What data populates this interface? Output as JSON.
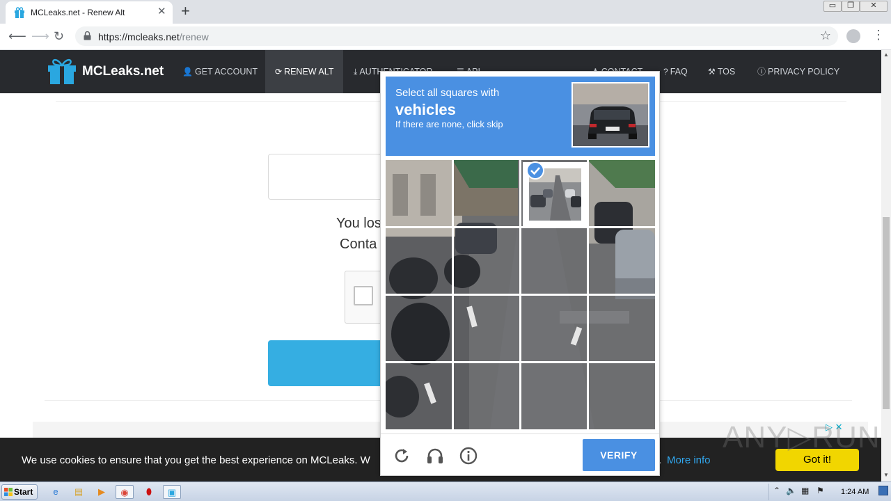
{
  "browser": {
    "tab_title": "MCLeaks.net - Renew Alt",
    "tab_close": "✕",
    "new_tab": "+",
    "url_host": "https://mcleaks.net",
    "url_path": "/renew",
    "window_buttons": [
      "▭",
      "❐",
      "✕"
    ]
  },
  "site": {
    "logo_text": "MCLeaks.net",
    "nav": [
      {
        "icon": "user-plus-icon",
        "label": "GET ACCOUNT"
      },
      {
        "icon": "refresh-icon",
        "label": "RENEW ALT"
      },
      {
        "icon": "download-icon",
        "label": "AUTHENTICATOR"
      },
      {
        "icon": "list-icon",
        "label": "API"
      },
      {
        "icon": "person-icon",
        "label": "CONTACT"
      },
      {
        "icon": "question-icon",
        "label": "FAQ"
      },
      {
        "icon": "gavel-icon",
        "label": "TOS"
      },
      {
        "icon": "info-icon",
        "label": "PRIVACY POLICY"
      }
    ],
    "line1": "You los",
    "line2": "Conta",
    "cookie_text": "We use cookies to ensure that you get the best experience on MCLeaks. W",
    "cookie_tail": ".",
    "cookie_more": "More info",
    "cookie_button": "Got it!",
    "ad_choices": "▷ ✕",
    "watermark": "ANY▷RUN"
  },
  "captcha": {
    "prompt_line1": "Select all squares with",
    "prompt_target": "vehicles",
    "prompt_line3": "If there are none, click skip",
    "verify_label": "VERIFY",
    "grid_size": 4,
    "selected_tiles": [
      2
    ],
    "colors": {
      "accent": "#4a90e2"
    }
  },
  "taskbar": {
    "start_label": "Start",
    "clock": "1:24 AM",
    "apps": [
      "ie-icon",
      "explorer-icon",
      "media-player-icon",
      "chrome-icon",
      "opera-icon",
      "gift-app-icon"
    ]
  }
}
